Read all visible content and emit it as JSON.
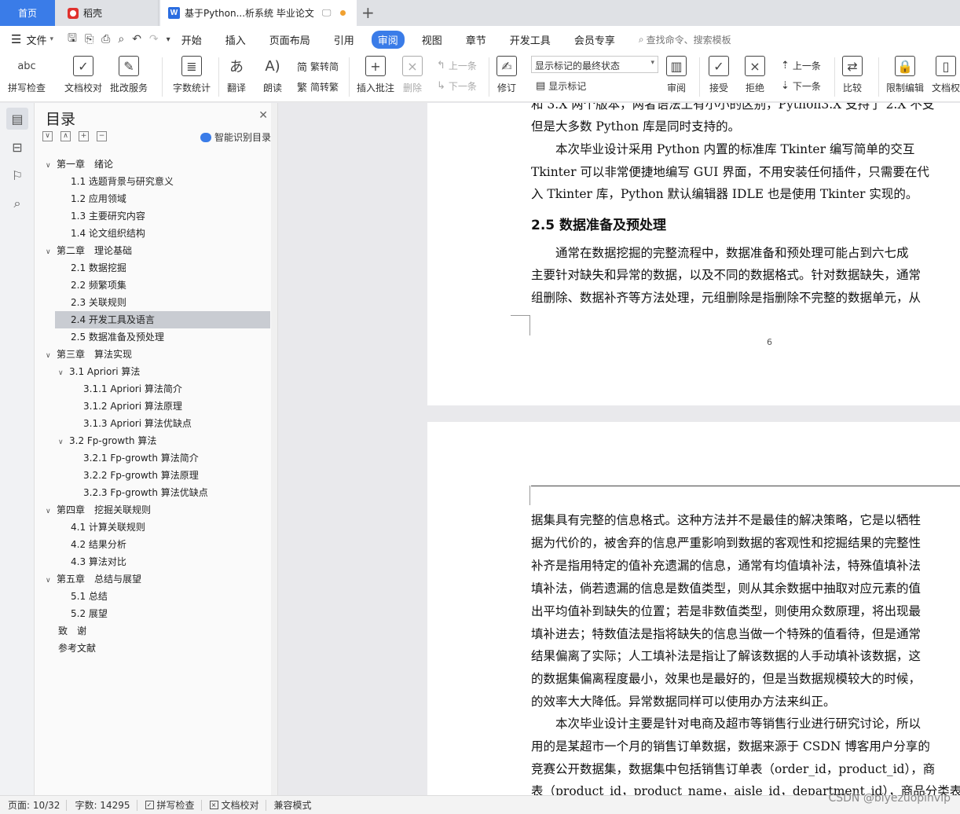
{
  "tabs": {
    "home": "首页",
    "daoke": "稻壳",
    "doc_title": "基于Python...析系统 毕业论文",
    "new_tab": "+"
  },
  "menu": {
    "file": "文件",
    "items": [
      "开始",
      "插入",
      "页面布局",
      "引用",
      "审阅",
      "视图",
      "章节",
      "开发工具",
      "会员专享"
    ],
    "active": "审阅",
    "search": "查找命令、搜索模板"
  },
  "ribbon": {
    "spell": "拼写检查",
    "doc_check": "文档校对",
    "correct_service": "批改服务",
    "word_count": "字数统计",
    "translate": "翻译",
    "read_aloud": "朗读",
    "trad": "繁转简",
    "simp": "简转繁",
    "insert_comment": "插入批注",
    "delete": "删除",
    "prev_comment": "上一条",
    "next_comment": "下一条",
    "revise": "修订",
    "markup_state": "显示标记的最终状态",
    "show_markup": "显示标记",
    "review": "审阅",
    "accept": "接受",
    "reject": "拒绝",
    "prev_change": "上一条",
    "next_change": "下一条",
    "compare": "比较",
    "restrict": "限制编辑",
    "doc_rights": "文档权"
  },
  "toc": {
    "title": "目录",
    "smart": "智能识别目录",
    "items": [
      {
        "text": "第一章　绪论",
        "level": 1,
        "arrow": "∨"
      },
      {
        "text": "1.1  选题背景与研究意义",
        "level": 2
      },
      {
        "text": "1.2  应用领域",
        "level": 2
      },
      {
        "text": "1.3  主要研究内容",
        "level": 2
      },
      {
        "text": "1.4  论文组织结构",
        "level": 2
      },
      {
        "text": "第二章　理论基础",
        "level": 1,
        "arrow": "∨"
      },
      {
        "text": "2.1  数据挖掘",
        "level": 2
      },
      {
        "text": "2.2  频繁项集",
        "level": 2
      },
      {
        "text": "2.3  关联规则",
        "level": 2
      },
      {
        "text": "2.4  开发工具及语言",
        "level": 2,
        "selected": true
      },
      {
        "text": "2.5  数据准备及预处理",
        "level": 2
      },
      {
        "text": "第三章　算法实现",
        "level": 1,
        "arrow": "∨"
      },
      {
        "text": "3.1 Apriori 算法",
        "level": 2,
        "arrow": "∨"
      },
      {
        "text": "3.1.1 Apriori 算法简介",
        "level": 3
      },
      {
        "text": "3.1.2 Apriori 算法原理",
        "level": 3
      },
      {
        "text": "3.1.3 Apriori 算法优缺点",
        "level": 3
      },
      {
        "text": "3.2 Fp-growth 算法",
        "level": 2,
        "arrow": "∨"
      },
      {
        "text": "3.2.1 Fp-growth 算法简介",
        "level": 3
      },
      {
        "text": "3.2.2 Fp-growth 算法原理",
        "level": 3
      },
      {
        "text": "3.2.3 Fp-growth 算法优缺点",
        "level": 3
      },
      {
        "text": "第四章　挖掘关联规则",
        "level": 1,
        "arrow": "∨"
      },
      {
        "text": "4.1  计算关联规则",
        "level": 2
      },
      {
        "text": "4.2  结果分析",
        "level": 2
      },
      {
        "text": "4.3  算法对比",
        "level": 2
      },
      {
        "text": "第五章　总结与展望",
        "level": 1,
        "arrow": "∨"
      },
      {
        "text": "5.1  总结",
        "level": 2
      },
      {
        "text": "5.2  展望",
        "level": 2
      },
      {
        "text": "致　谢",
        "level": 1
      },
      {
        "text": "参考文献",
        "level": 1
      }
    ]
  },
  "page1": {
    "lines": [
      "和 3.X 两个版本，两者语法上有小小的区别，Python3.X 支持了 2.X 不支",
      "但是大多数 Python 库是同时支持的。",
      "　　本次毕业设计采用 Python 内置的标准库 Tkinter 编写简单的交互",
      "Tkinter 可以非常便捷地编写 GUI 界面，不用安装任何插件，只需要在代",
      "入 Tkinter 库，Python 默认编辑器 IDLE 也是使用 Tkinter 实现的。"
    ],
    "heading": "2.5  数据准备及预处理",
    "lines2": [
      "　　通常在数据挖掘的完整流程中，数据准备和预处理可能占到六七成",
      "主要针对缺失和异常的数据，以及不同的数据格式。针对数据缺失，通常",
      "组删除、数据补齐等方法处理，元组删除是指删除不完整的数据单元，从"
    ],
    "page_number": "6"
  },
  "page2": {
    "lines": [
      "据集具有完整的信息格式。这种方法并不是最佳的解决策略，它是以牺牲",
      "据为代价的，被舍弃的信息严重影响到数据的客观性和挖掘结果的完整性",
      "补齐是指用特定的值补充遗漏的信息，通常有均值填补法，特殊值填补法",
      "填补法，倘若遗漏的信息是数值类型，则从其余数据中抽取对应元素的值",
      "出平均值补到缺失的位置；若是非数值类型，则使用众数原理，将出现最",
      "填补进去；特数值法是指将缺失的信息当做一个特殊的值看待，但是通常",
      "结果偏离了实际；人工填补法是指让了解该数据的人手动填补该数据，这",
      "的数据集偏离程度最小，效果也是最好的，但是当数据规模较大的时候，",
      "的效率大大降低。异常数据同样可以使用办方法来纠正。",
      "　　本次毕业设计主要是针对电商及超市等销售行业进行研究讨论，所以",
      "用的是某超市一个月的销售订单数据，数据来源于 CSDN 博客用户分享的",
      "竞赛公开数据集，数据集中包括销售订单表（order_id，product_id），商",
      "表（product_id，product_name，aisle_id，department_id），商品分类表（"
    ]
  },
  "status": {
    "page": "页面: 10/32",
    "words": "字数: 14295",
    "spell": "拼写检查",
    "doc_check": "文档校对",
    "compat": "兼容模式"
  },
  "watermark": "CSDN @biyezuopinvip"
}
